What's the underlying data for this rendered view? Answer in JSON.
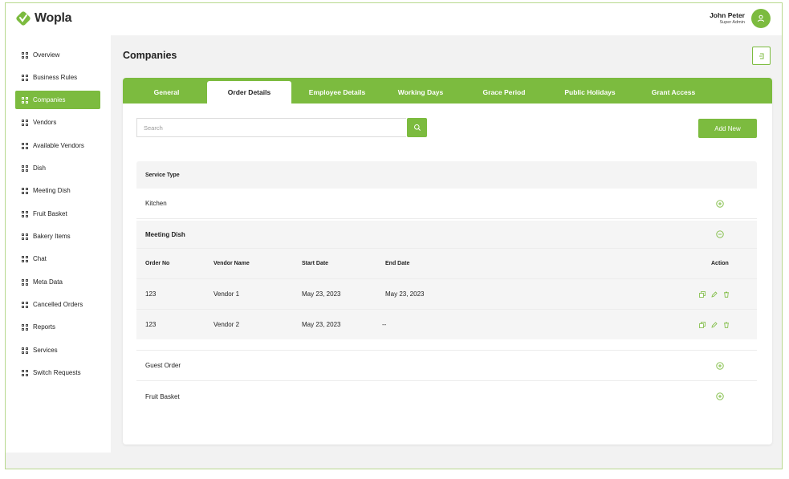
{
  "app": {
    "logo_text": "Wopla",
    "accent": "#7cbb3f"
  },
  "user": {
    "name": "John Peter",
    "role": "Super Admin"
  },
  "sidebar": {
    "items": [
      {
        "label": "Overview"
      },
      {
        "label": "Business Rules"
      },
      {
        "label": "Companies",
        "active": true
      },
      {
        "label": "Vendors"
      },
      {
        "label": "Available Vendors"
      },
      {
        "label": "Dish"
      },
      {
        "label": "Meeting Dish"
      },
      {
        "label": "Fruit Basket"
      },
      {
        "label": "Bakery Items"
      },
      {
        "label": "Chat"
      },
      {
        "label": "Meta Data"
      },
      {
        "label": "Cancelled Orders"
      },
      {
        "label": "Reports"
      },
      {
        "label": "Services"
      },
      {
        "label": "Switch Requests"
      }
    ]
  },
  "page": {
    "title": "Companies"
  },
  "tabs": [
    {
      "label": "General"
    },
    {
      "label": "Order Details",
      "active": true
    },
    {
      "label": "Employee Details"
    },
    {
      "label": "Working Days"
    },
    {
      "label": "Grace Period"
    },
    {
      "label": "Public Holidays"
    },
    {
      "label": "Grant Access"
    }
  ],
  "search": {
    "placeholder": "Search",
    "value": ""
  },
  "add_button": "Add New",
  "table": {
    "header": "Service Type",
    "services": [
      {
        "name": "Kitchen",
        "state": "collapsed"
      },
      {
        "name": "Meeting Dish",
        "state": "expanded"
      },
      {
        "name": "Guest Order",
        "state": "collapsed"
      },
      {
        "name": "Fruit Basket",
        "state": "collapsed"
      }
    ],
    "sub_columns": [
      "Order No",
      "Vendor Name",
      "Start Date",
      "End Date",
      "Action"
    ],
    "sub_rows": [
      {
        "order_no": "123",
        "vendor": "Vendor 1",
        "start": "May 23, 2023",
        "end": "May 23, 2023"
      },
      {
        "order_no": "123",
        "vendor": "Vendor 2",
        "start": "May 23, 2023",
        "end": "--"
      }
    ]
  }
}
